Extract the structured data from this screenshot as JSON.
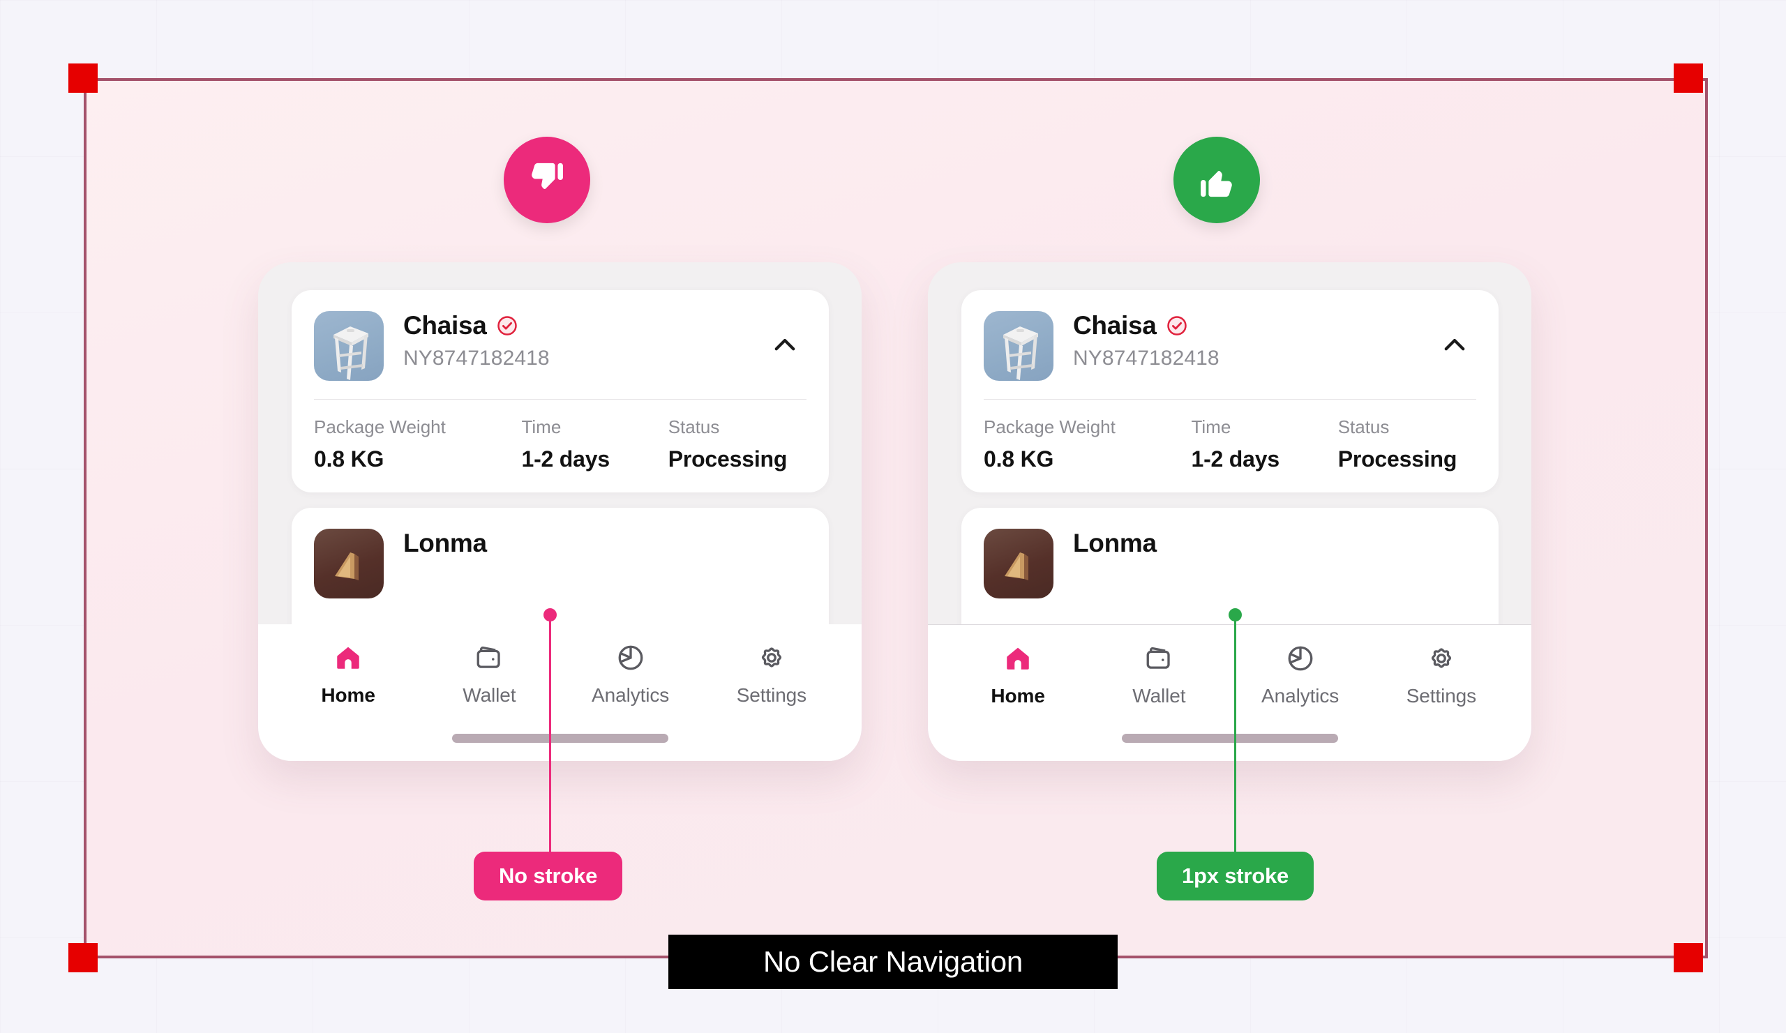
{
  "banner": {
    "text": "No Clear Navigation"
  },
  "panels": [
    {
      "key": "bad",
      "verdict_icon": "thumbs-down-icon",
      "accent": "#ec2a7b",
      "nav_has_stroke": false,
      "callout": {
        "label": "No stroke"
      }
    },
    {
      "key": "good",
      "verdict_icon": "thumbs-up-icon",
      "accent": "#2aa84a",
      "nav_has_stroke": true,
      "callout": {
        "label": "1px stroke"
      }
    }
  ],
  "cards": {
    "first": {
      "product_name": "Chaisa",
      "verified": true,
      "order_id": "NY8747182418",
      "thumbnail": "white-stool-image",
      "expand_state": "expanded",
      "meta": [
        {
          "label": "Package Weight",
          "value": "0.8 KG"
        },
        {
          "label": "Time",
          "value": "1-2 days"
        },
        {
          "label": "Status",
          "value": "Processing"
        }
      ]
    },
    "second": {
      "product_name": "Lonma",
      "order_id": "",
      "thumbnail": "wooden-product-image"
    }
  },
  "bottom_nav": {
    "items": [
      {
        "label": "Home",
        "icon": "home-icon",
        "active": true
      },
      {
        "label": "Wallet",
        "icon": "wallet-icon",
        "active": false
      },
      {
        "label": "Analytics",
        "icon": "analytics-icon",
        "active": false
      },
      {
        "label": "Settings",
        "icon": "settings-icon",
        "active": false
      }
    ]
  },
  "colors": {
    "accent_pink": "#ec2a7b",
    "accent_green": "#2aa84a",
    "frame_border": "#a4526b",
    "corner_marker": "#e60000",
    "canvas": "#f5f4fa",
    "frame_fill": "#fdeff1",
    "verified_red": "#e0213c"
  }
}
